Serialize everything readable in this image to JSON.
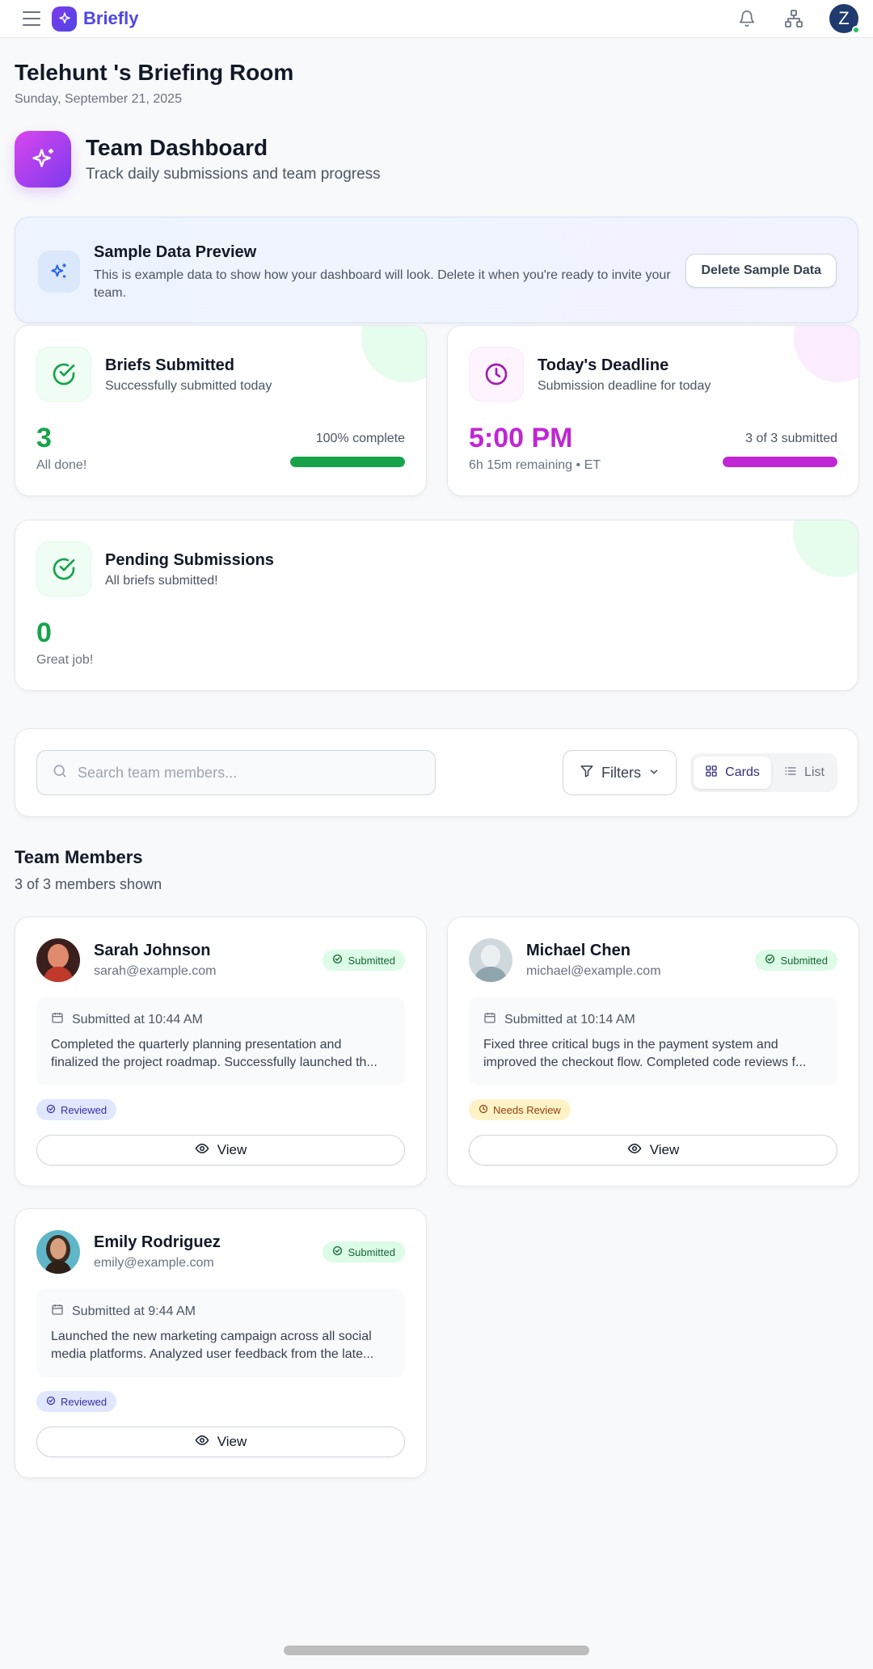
{
  "app": {
    "name": "Briefly"
  },
  "user": {
    "initial": "Z"
  },
  "room": {
    "title": "Telehunt 's Briefing Room",
    "date": "Sunday, September 21, 2025"
  },
  "dashboard": {
    "title": "Team Dashboard",
    "subtitle": "Track daily submissions and team progress"
  },
  "sample_banner": {
    "title": "Sample Data Preview",
    "description": "This is example data to show how your dashboard will look. Delete it when you're ready to invite your team.",
    "button_label": "Delete Sample Data"
  },
  "stats": {
    "briefs": {
      "title": "Briefs Submitted",
      "subtitle": "Successfully submitted today",
      "value": "3",
      "note": "All done!",
      "progress_label": "100% complete",
      "progress": 1.0,
      "color": "#16a34a"
    },
    "deadline": {
      "title": "Today's Deadline",
      "subtitle": "Submission deadline for today",
      "value": "5:00 PM",
      "note": "6h 15m remaining • ET",
      "progress_label": "3 of 3 submitted",
      "progress": 1.0,
      "color": "#c026d3"
    },
    "pending": {
      "title": "Pending Submissions",
      "subtitle": "All briefs submitted!",
      "value": "0",
      "note": "Great job!",
      "color": "#16a34a"
    }
  },
  "toolbar": {
    "search_placeholder": "Search team members...",
    "filters_label": "Filters",
    "view_cards": "Cards",
    "view_list": "List",
    "active_view": "Cards"
  },
  "members_section": {
    "title": "Team Members",
    "count": "3 of 3 members shown"
  },
  "members": [
    {
      "name": "Sarah Johnson",
      "email": "sarah@example.com",
      "status": "Submitted",
      "time": "Submitted at 10:44 AM",
      "note": "Completed the quarterly planning presentation and finalized the project roadmap. Successfully launched th...",
      "review": "Reviewed",
      "view_label": "View"
    },
    {
      "name": "Michael Chen",
      "email": "michael@example.com",
      "status": "Submitted",
      "time": "Submitted at 10:14 AM",
      "note": "Fixed three critical bugs in the payment system and improved the checkout flow. Completed code reviews f...",
      "review": "Needs Review",
      "view_label": "View"
    },
    {
      "name": "Emily Rodriguez",
      "email": "emily@example.com",
      "status": "Submitted",
      "time": "Submitted at 9:44 AM",
      "note": "Launched the new marketing campaign across all social media platforms. Analyzed user feedback from the late...",
      "review": "Reviewed",
      "view_label": "View"
    }
  ],
  "colors": {
    "accent": "#4f46e5",
    "success": "#16a34a",
    "magenta": "#c026d3"
  }
}
